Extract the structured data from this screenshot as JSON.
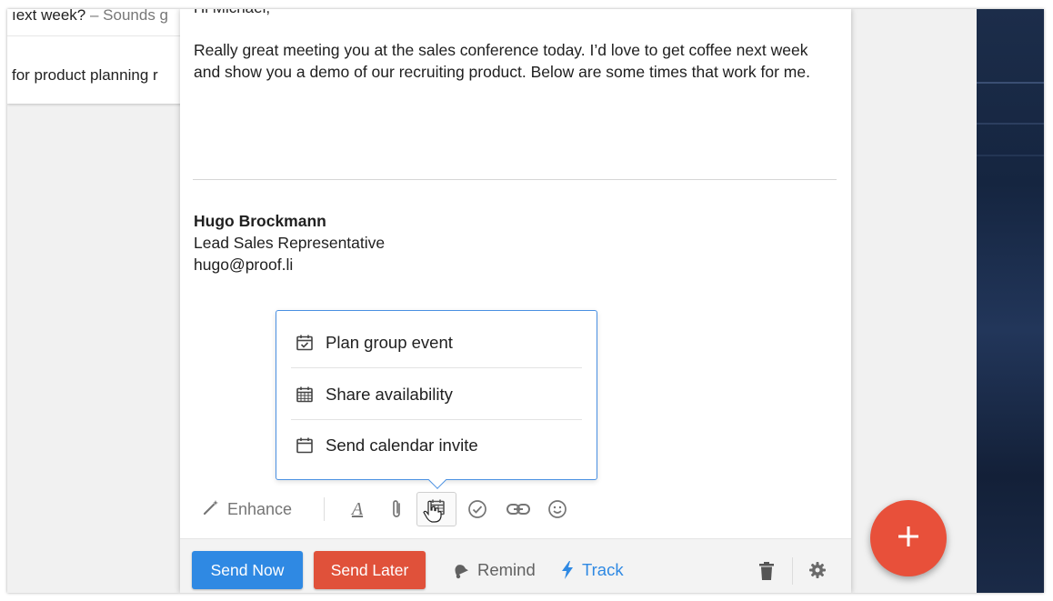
{
  "inbox": {
    "rows": [
      {
        "subject": "ıext week?",
        "separator": " – ",
        "snippet": "Sounds g"
      },
      {
        "subject": "for product planning r",
        "separator": "",
        "snippet": ""
      }
    ]
  },
  "compose": {
    "greeting": "Hi Michael,",
    "body": "Really great meeting you at the sales conference today. I’d love to get coffee next week and show you a demo of our recruiting product. Below are some times that work for me.",
    "signature": {
      "name": "Hugo Brockmann",
      "title": "Lead Sales Representative",
      "email": "hugo@proof.li"
    }
  },
  "calendar_menu": {
    "items": [
      {
        "label": "Plan group event",
        "icon": "calendar-check-icon"
      },
      {
        "label": "Share availability",
        "icon": "calendar-grid-icon"
      },
      {
        "label": "Send calendar invite",
        "icon": "calendar-icon"
      }
    ]
  },
  "toolbar": {
    "enhance_label": "Enhance",
    "font_glyph": "A",
    "icons": [
      "magic-wand-icon",
      "text-format-icon",
      "paperclip-icon",
      "calendar-icon",
      "check-circle-icon",
      "link-icon",
      "emoji-icon"
    ]
  },
  "footer": {
    "send_now_label": "Send Now",
    "send_later_label": "Send Later",
    "remind_label": "Remind",
    "track_label": "Track"
  },
  "fab": {
    "glyph": "+"
  },
  "colors": {
    "primary_blue": "#2f89e3",
    "send_later_red": "#e0513a",
    "fab_red": "#e8503a",
    "popup_border": "#4a90e2"
  }
}
